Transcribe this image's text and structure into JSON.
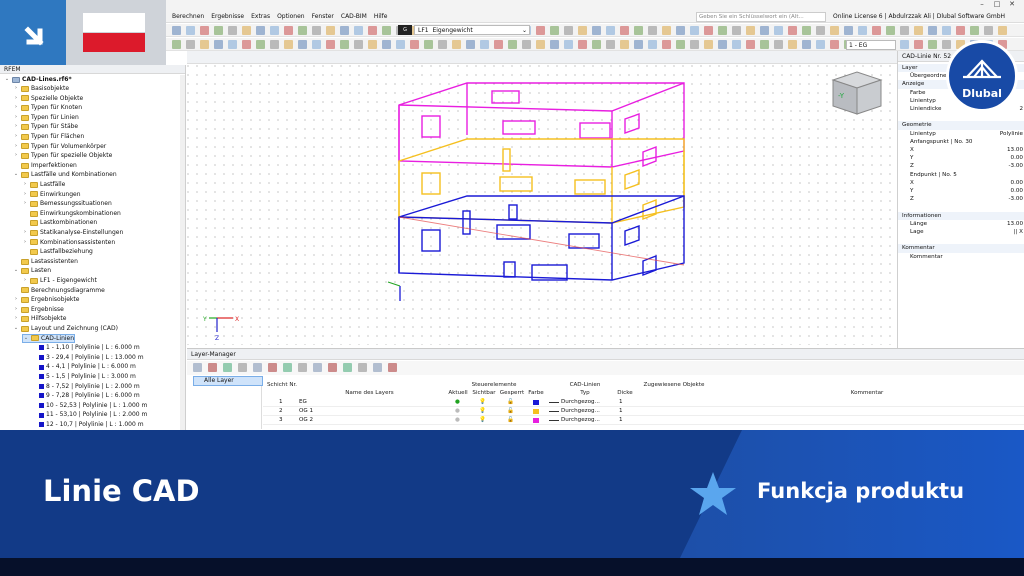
{
  "menu": {
    "items": [
      "Berechnen",
      "Ergebnisse",
      "Extras",
      "Optionen",
      "Fenster",
      "CAD-BIM",
      "Hilfe"
    ],
    "search_placeholder": "Geben Sie ein Schlüsselwort ein (Alt...",
    "license": "Online License 6 | Abdulrzzak Ali | Dlubal Software GmbH"
  },
  "toolbar": {
    "loadcase_code": "G",
    "loadcase_id": "LF1",
    "loadcase_name": "Eigengewicht",
    "level_select": "1 - EG"
  },
  "navigator": {
    "title": "RFEM",
    "file": "CAD-Lines.rf6*",
    "items": [
      {
        "label": "Basisobjekte",
        "level": 1,
        "exp": "›"
      },
      {
        "label": "Spezielle Objekte",
        "level": 1,
        "exp": "›"
      },
      {
        "label": "Typen für Knoten",
        "level": 1,
        "exp": "›"
      },
      {
        "label": "Typen für Linien",
        "level": 1,
        "exp": "›"
      },
      {
        "label": "Typen für Stäbe",
        "level": 1,
        "exp": "›"
      },
      {
        "label": "Typen für Flächen",
        "level": 1,
        "exp": "›"
      },
      {
        "label": "Typen für Volumenkörper",
        "level": 1,
        "exp": "›"
      },
      {
        "label": "Typen für spezielle Objekte",
        "level": 1,
        "exp": "›"
      },
      {
        "label": "Imperfektionen",
        "level": 1,
        "exp": ""
      },
      {
        "label": "Lastfälle und Kombinationen",
        "level": 1,
        "exp": "⌄"
      },
      {
        "label": "Lastfälle",
        "level": 2,
        "exp": "›"
      },
      {
        "label": "Einwirkungen",
        "level": 2,
        "exp": "›"
      },
      {
        "label": "Bemessungssituationen",
        "level": 2,
        "exp": "›"
      },
      {
        "label": "Einwirkungskombinationen",
        "level": 2,
        "exp": ""
      },
      {
        "label": "Lastkombinationen",
        "level": 2,
        "exp": ""
      },
      {
        "label": "Statikanalyse-Einstellungen",
        "level": 2,
        "exp": "›"
      },
      {
        "label": "Kombinationsassistenten",
        "level": 2,
        "exp": "›"
      },
      {
        "label": "Lastfallbeziehung",
        "level": 2,
        "exp": ""
      },
      {
        "label": "Lastassistenten",
        "level": 1,
        "exp": ""
      },
      {
        "label": "Lasten",
        "level": 1,
        "exp": "⌄"
      },
      {
        "label": "LF1 - Eigengewicht",
        "level": 2,
        "exp": "›"
      },
      {
        "label": "Berechnungsdiagramme",
        "level": 1,
        "exp": ""
      },
      {
        "label": "Ergebnisobjekte",
        "level": 1,
        "exp": "›"
      },
      {
        "label": "Ergebnisse",
        "level": 1,
        "exp": "›"
      },
      {
        "label": "Hilfsobjekte",
        "level": 1,
        "exp": "›"
      },
      {
        "label": "Layout und Zeichnung (CAD)",
        "level": 1,
        "exp": "⌄"
      },
      {
        "label": "CAD-Linien",
        "level": 2,
        "exp": "⌄",
        "selected": true
      },
      {
        "label": "1 - 1,10 | Polylinie | L : 6.000 m",
        "level": 3,
        "exp": "",
        "leaf": true
      },
      {
        "label": "3 - 29,4 | Polylinie | L : 13.000 m",
        "level": 3,
        "exp": "",
        "leaf": true
      },
      {
        "label": "4 - 4,1 | Polylinie | L : 6.000 m",
        "level": 3,
        "exp": "",
        "leaf": true
      },
      {
        "label": "5 - 1,5 | Polylinie | L : 3.000 m",
        "level": 3,
        "exp": "",
        "leaf": true
      },
      {
        "label": "8 - 7,52 | Polylinie | L : 2.000 m",
        "level": 3,
        "exp": "",
        "leaf": true
      },
      {
        "label": "9 - 7,28 | Polylinie | L : 6.000 m",
        "level": 3,
        "exp": "",
        "leaf": true
      },
      {
        "label": "10 - 52,53 | Polylinie | L : 1.000 m",
        "level": 3,
        "exp": "",
        "leaf": true
      },
      {
        "label": "11 - 53,10 | Polylinie | L : 2.000 m",
        "level": 3,
        "exp": "",
        "leaf": true
      },
      {
        "label": "12 - 10,7 | Polylinie | L : 1.000 m",
        "level": 3,
        "exp": "",
        "leaf": true
      }
    ]
  },
  "properties": {
    "title": "CAD-Linie Nr. 52",
    "rows": [
      {
        "label": "Layer",
        "value": "",
        "group": true
      },
      {
        "label": "Übergeordnet",
        "value": "",
        "group": false
      },
      {
        "label": "Anzeige",
        "value": "",
        "group": true
      },
      {
        "label": "Farbe",
        "value": "",
        "group": false
      },
      {
        "label": "Linientyp",
        "value": "",
        "group": false
      },
      {
        "label": "Liniendicke",
        "value": "2",
        "group": false
      },
      {
        "label": "",
        "value": "",
        "group": false
      },
      {
        "label": "Geometrie",
        "value": "",
        "group": true
      },
      {
        "label": "Linientyp",
        "value": "Polylinie",
        "group": false
      },
      {
        "label": "Anfangspunkt | No. 30",
        "value": "",
        "group": false
      },
      {
        "label": "X",
        "value": "13.00",
        "group": false
      },
      {
        "label": "Y",
        "value": "0.00",
        "group": false
      },
      {
        "label": "Z",
        "value": "-3.00",
        "group": false
      },
      {
        "label": "Endpunkt | No. 5",
        "value": "",
        "group": false
      },
      {
        "label": "X",
        "value": "0.00",
        "group": false
      },
      {
        "label": "Y",
        "value": "0.00",
        "group": false
      },
      {
        "label": "Z",
        "value": "-3.00",
        "group": false
      },
      {
        "label": "",
        "value": "",
        "group": false
      },
      {
        "label": "Informationen",
        "value": "",
        "group": true
      },
      {
        "label": "Länge",
        "value": "13.00",
        "group": false
      },
      {
        "label": "Lage",
        "value": "|| X",
        "group": false
      },
      {
        "label": "",
        "value": "",
        "group": false
      },
      {
        "label": "Kommentar",
        "value": "",
        "group": true
      },
      {
        "label": "Kommentar",
        "value": "",
        "group": false
      }
    ]
  },
  "layer_manager": {
    "title": "Layer-Manager",
    "all_layers": "Alle Layer",
    "headers": {
      "no": "Schicht Nr.",
      "name": "Name des Layers",
      "control": "Steuerelemente",
      "current": "Aktuell",
      "visible": "Sichtbar",
      "locked": "Gesperrt",
      "color": "Farbe",
      "cad": "CAD-Linien",
      "type": "Typ",
      "thickness": "Dicke",
      "assigned": "Zugewiesene Objekte",
      "comment": "Kommentar"
    },
    "rows": [
      {
        "no": "1",
        "name": "EG",
        "type": "Durchgezog...",
        "thickness": "1",
        "color": "#1a1ad6"
      },
      {
        "no": "2",
        "name": "OG 1",
        "type": "Durchgezog...",
        "thickness": "1",
        "color": "#f5c020"
      },
      {
        "no": "3",
        "name": "OG 2",
        "type": "Durchgezog...",
        "thickness": "1",
        "color": "#e81fe0"
      }
    ]
  },
  "banner": {
    "product": "Linie CAD",
    "feature": "Funkcja produktu",
    "brand": "Dlubal"
  },
  "colors": {
    "banner": "#123a87",
    "accent": "#2f78c0",
    "eg": "#1a1ad6",
    "og1": "#f5c020",
    "og2": "#e81fe0"
  }
}
